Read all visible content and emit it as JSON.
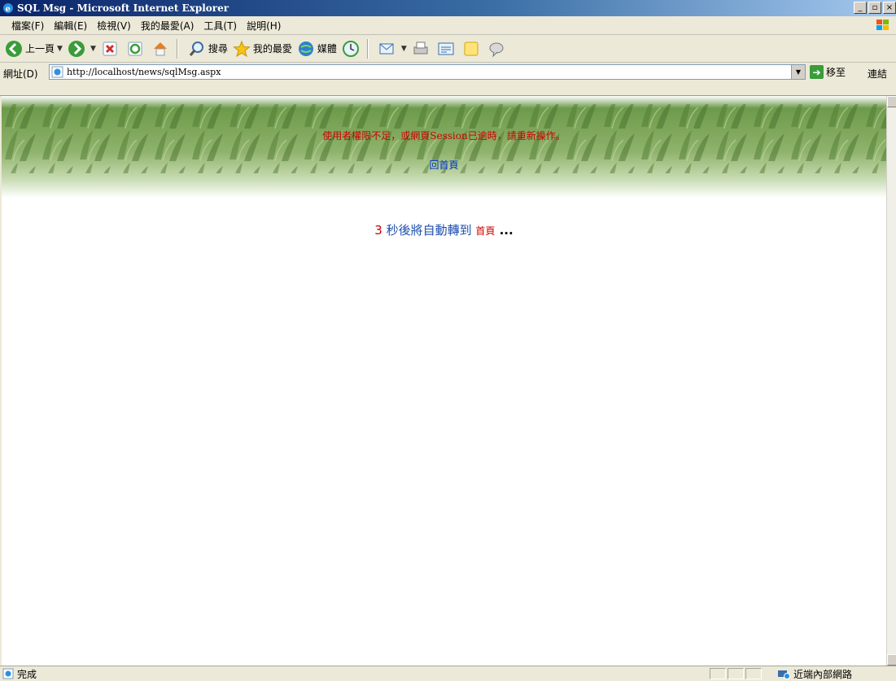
{
  "window": {
    "title": "SQL Msg - Microsoft Internet Explorer"
  },
  "menu": {
    "items": [
      "檔案(F)",
      "編輯(E)",
      "檢視(V)",
      "我的最愛(A)",
      "工具(T)",
      "說明(H)"
    ]
  },
  "toolbar": {
    "back_label": "上一頁",
    "search_label": "搜尋",
    "favorites_label": "我的最愛",
    "media_label": "媒體"
  },
  "address": {
    "label": "網址(D)",
    "url": "http://localhost/news/sqlMsg.aspx",
    "go_label": "移至",
    "links_label": "連結"
  },
  "page": {
    "message": "使用者權限不足，或網頁Session已逾時，請重新操作。",
    "home_link": "回首頁",
    "redirect_count": "3",
    "redirect_text": " 秒後將自動轉到 ",
    "redirect_home": "首頁",
    "redirect_dots": " ..."
  },
  "status": {
    "text": "完成",
    "zone": "近端內部網路"
  },
  "colors": {
    "message": "#cc0000",
    "link": "#0033cc",
    "titlebar": "#0a246a"
  }
}
